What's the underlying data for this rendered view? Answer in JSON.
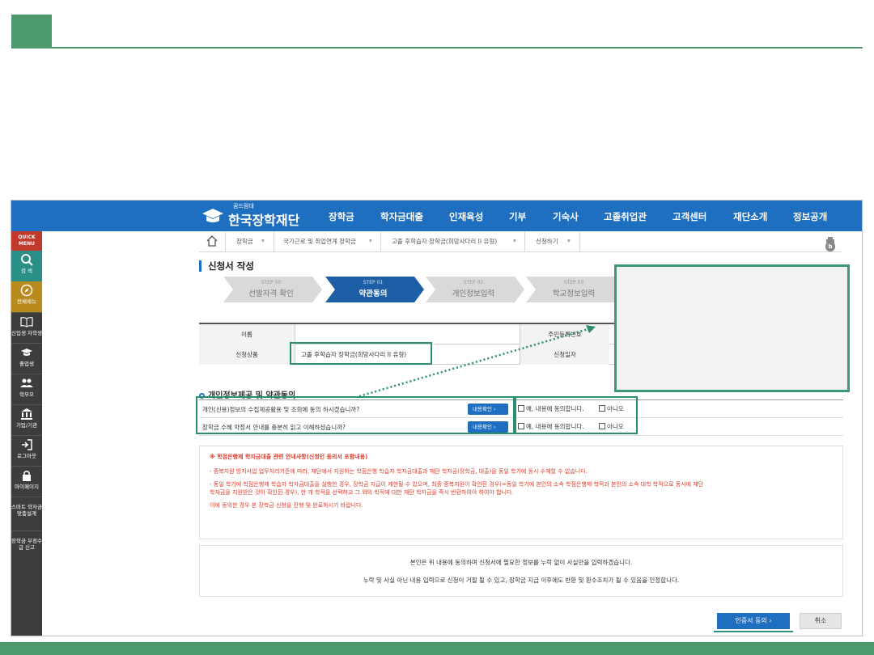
{
  "header": {
    "logo_small": "꿈드림대",
    "logo_text": "한국장학재단"
  },
  "nav": [
    "장학금",
    "학자금대출",
    "인재육성",
    "기부",
    "기숙사",
    "고졸취업관",
    "고객센터",
    "재단소개",
    "정보공개"
  ],
  "quick_menu": {
    "title": "QUICK MENU",
    "items": [
      {
        "label": "검 색",
        "icon": "search-icon"
      },
      {
        "label": "전체메뉴",
        "icon": "compass-icon"
      },
      {
        "label": "신입생 자학생",
        "icon": "book-icon"
      },
      {
        "label": "졸업생",
        "icon": "graduation-cap-icon"
      },
      {
        "label": "학부모",
        "icon": "people-icon"
      },
      {
        "label": "기업/기관",
        "icon": "building-icon"
      },
      {
        "label": "로그아웃",
        "icon": "logout-icon"
      },
      {
        "label": "마이페이지",
        "icon": "lock-icon"
      },
      {
        "label": "스마트 학자금 맞춤설계",
        "icon": ""
      },
      {
        "label": "장학금 부정수급 신고",
        "icon": ""
      }
    ]
  },
  "breadcrumb": [
    "장학금",
    "국가근로 및 취업연계 장학금",
    "고졸 후학습자 장학금(희망사다리 II 유형)",
    "신청하기"
  ],
  "toolbar_icons": [
    "+",
    "−",
    "print-icon",
    "facebook-icon",
    "twitter-icon",
    "blog-icon"
  ],
  "page_title": "신청서 작성",
  "steps": [
    {
      "num": "STEP 00",
      "label": "선발자격 확인",
      "active": false
    },
    {
      "num": "STEP 01",
      "label": "약관동의",
      "active": true
    },
    {
      "num": "STEP 02",
      "label": "개인정보입력",
      "active": false
    },
    {
      "num": "STEP 03",
      "label": "학교정보입력",
      "active": false
    }
  ],
  "info": {
    "name_label": "이름",
    "name_value": "",
    "rrn_label": "주민등록번호",
    "product_label": "신청상품",
    "product_value": "고졸 후학습자 장학금(희망사다리 II 유형)",
    "date_label": "신청일자"
  },
  "section_title": "개인정보제공 및 약관동의",
  "agreements": [
    {
      "question": "개인(신용)정보의 수집제공활용 및 조회에 동의 하시겠습니까?",
      "button": "내용확인",
      "yes": "예, 내용에 동의합니다.",
      "no": "아니오"
    },
    {
      "question": "장학금 수혜 약정서 안내를 충분히 읽고 이해하셨습니까?",
      "button": "내용확인",
      "yes": "예, 내용에 동의합니다.",
      "no": "아니오"
    }
  ],
  "notice": {
    "heading": "※ 학점은행제 학자금대출 관련 안내사항(신청인 동의서 포함내용)",
    "line1": "- 중복지원 방지사업 업무처리기준에 따라, 재단에서 지원하는 학점은행 학습자 학자금대출과 재단 학자금(장학금, 대출)을 동일 학기에 동시 수혜할 수 없습니다.",
    "line2a": "- 동일 학기에 학점은행제 학습자 학자금대출을 실행한 경우, 장학금 지급이 제한될 수 있으며, 최종 중복지원이 확인된 경우(=동일 학기에 본인의 소속 학점은행제 학적과 본인의 소속 대학 학적으로 동시에 재단",
    "line2b": "학자금을 지원받은 것이 확인된 경우), 한 개 학적을 선택하고 그 외의 학적에 대한 재단 학자금을 즉시 반환하여야 하여야 합니다.",
    "line3": "이에 동의한 경우 본 장학금 신청을 진행 및 완료하시기 바랍니다."
  },
  "pledge": {
    "line1": "본인은 위 내용에 동의하며 신청서에 필요한 정보를 누락 없이 사실만을 입력하겠습니다.",
    "line2": "누락 및 사실 아닌 내용 입력으로 신청이 거절 될 수 있고, 장학금 지급 이후에도 반환 및 환수조치가 될 수 있음을 인정합니다."
  },
  "buttons": {
    "confirm": "인증서 동의  ›",
    "cancel": "취소"
  },
  "colors": {
    "brand_blue": "#1e6fc0",
    "highlight_green": "#2a8f6d",
    "notice_red": "#e03a2a"
  }
}
